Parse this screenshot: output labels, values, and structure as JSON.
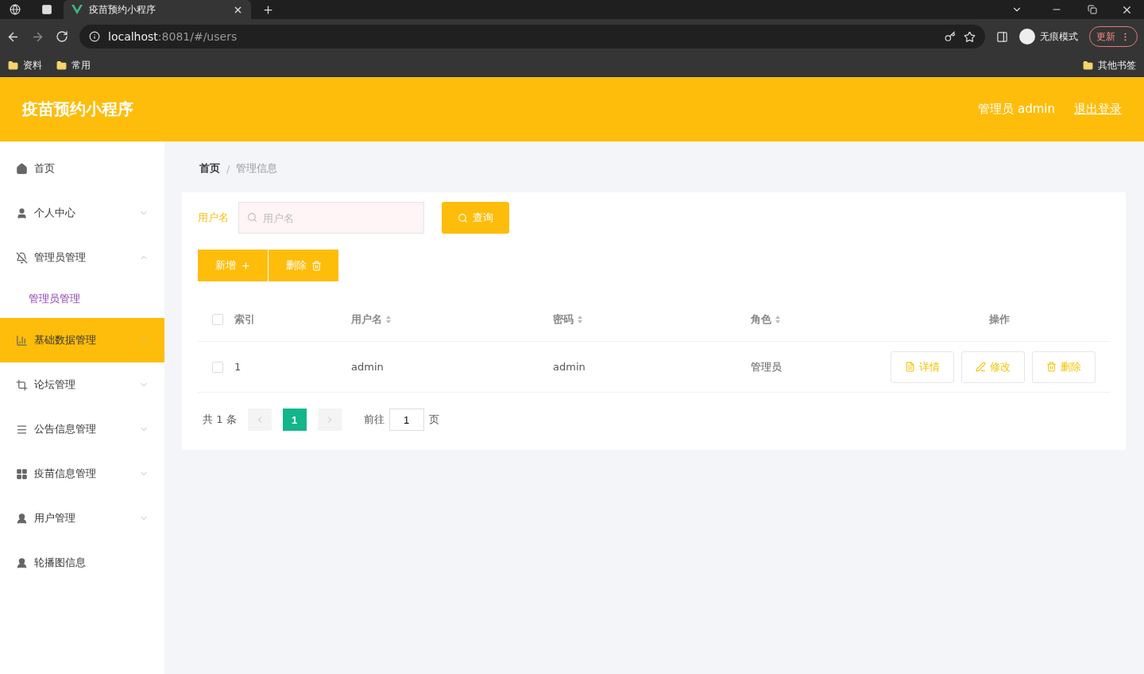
{
  "browser": {
    "tab_title": "疫苗预约小程序",
    "url_host": "localhost",
    "url_path": ":8081/#/users",
    "profile": "无痕模式",
    "update_button": "更新",
    "bookmarks": [
      "资料",
      "常用"
    ],
    "other_bookmarks": "其他书签"
  },
  "header": {
    "title": "疫苗预约小程序",
    "user": "管理员 admin",
    "logout": "退出登录"
  },
  "sidebar": {
    "items": [
      {
        "label": "首页",
        "kind": "home",
        "selected": false
      },
      {
        "label": "个人中心",
        "kind": "user",
        "expanded": false,
        "selected": false
      },
      {
        "label": "管理员管理",
        "kind": "admin",
        "expanded": true,
        "selected": false,
        "children": [
          {
            "label": "管理员管理",
            "selected": true
          }
        ]
      },
      {
        "label": "基础数据管理",
        "kind": "chart",
        "expanded": false,
        "selected": true
      },
      {
        "label": "论坛管理",
        "kind": "forum",
        "expanded": false,
        "selected": false
      },
      {
        "label": "公告信息管理",
        "kind": "notice",
        "expanded": false,
        "selected": false
      },
      {
        "label": "疫苗信息管理",
        "kind": "vaccine",
        "expanded": false,
        "selected": false
      },
      {
        "label": "用户管理",
        "kind": "person",
        "expanded": false,
        "selected": false
      },
      {
        "label": "轮播图信息",
        "kind": "person",
        "selected": false
      }
    ]
  },
  "breadcrumb": {
    "items": [
      "首页",
      "管理信息"
    ],
    "separator": "/"
  },
  "search": {
    "label": "用户名",
    "placeholder": "用户名",
    "button": "查询"
  },
  "actions": [
    {
      "label": "新增",
      "kind": "add"
    },
    {
      "label": "删除",
      "kind": "delete"
    }
  ],
  "table": {
    "all_checked": false,
    "columns": [
      {
        "label": "索引",
        "sortable": false
      },
      {
        "label": "用户名",
        "sortable": true
      },
      {
        "label": "密码",
        "sortable": true
      },
      {
        "label": "角色",
        "sortable": true
      },
      {
        "label": "操作",
        "sortable": false
      }
    ],
    "rows": [
      {
        "checked": false,
        "cells": [
          "1",
          "admin",
          "admin",
          "管理员"
        ],
        "actions": [
          {
            "label": "详情",
            "kind": "view"
          },
          {
            "label": "修改",
            "kind": "edit"
          },
          {
            "label": "删除",
            "kind": "delete"
          }
        ]
      }
    ]
  },
  "pagination": {
    "total": "共 1 条",
    "pages": [
      {
        "label": "1",
        "selected": true
      }
    ],
    "goto_label": "前往",
    "goto_value": "1",
    "page_suffix": "页"
  }
}
